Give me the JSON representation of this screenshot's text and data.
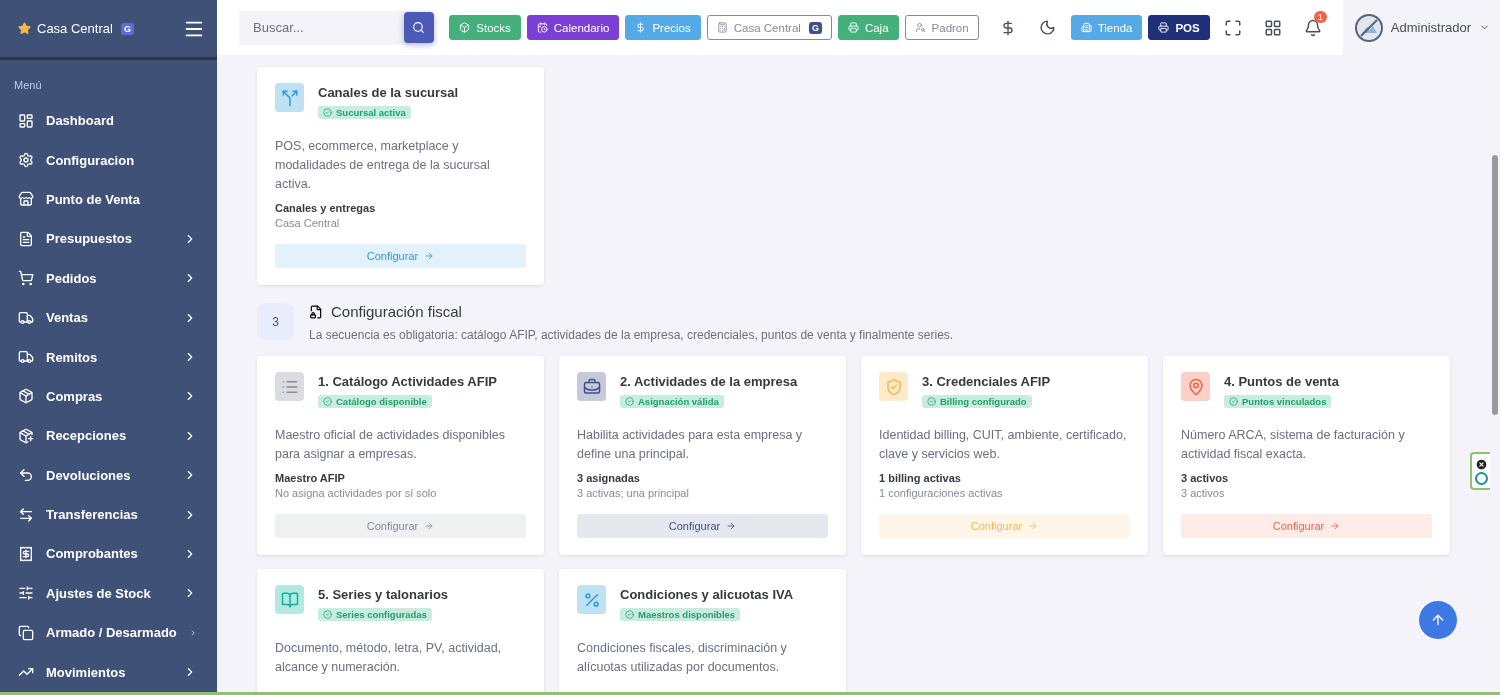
{
  "sidebar": {
    "brand": {
      "name": "Casa Central",
      "badge": "G"
    },
    "section_title": "Menú",
    "items": [
      {
        "label": "Dashboard",
        "expandable": false
      },
      {
        "label": "Configuracion",
        "expandable": false
      },
      {
        "label": "Punto de Venta",
        "expandable": false
      },
      {
        "label": "Presupuestos",
        "expandable": true
      },
      {
        "label": "Pedidos",
        "expandable": true
      },
      {
        "label": "Ventas",
        "expandable": true
      },
      {
        "label": "Remitos",
        "expandable": true
      },
      {
        "label": "Compras",
        "expandable": true
      },
      {
        "label": "Recepciones",
        "expandable": true
      },
      {
        "label": "Devoluciones",
        "expandable": true
      },
      {
        "label": "Transferencias",
        "expandable": true
      },
      {
        "label": "Comprobantes",
        "expandable": true
      },
      {
        "label": "Ajustes de Stock",
        "expandable": true
      },
      {
        "label": "Armado / Desarmado",
        "expandable": true
      },
      {
        "label": "Movimientos",
        "expandable": true
      }
    ]
  },
  "topbar": {
    "search": {
      "placeholder": "Buscar..."
    },
    "quick_buttons": [
      {
        "label": "Stocks",
        "kind": "solid",
        "color": "#45b07c"
      },
      {
        "label": "Calendario",
        "kind": "solid",
        "color": "#7b3fd4"
      },
      {
        "label": "Precios",
        "kind": "solid",
        "color": "#55a9e6"
      },
      {
        "label": "Casa Central",
        "kind": "outline",
        "color": "#878a99",
        "badge": "G"
      },
      {
        "label": "Caja",
        "kind": "solid",
        "color": "#45b07c"
      },
      {
        "label": "Padron",
        "kind": "outline",
        "color": "#878a99"
      }
    ],
    "mode_buttons": [
      {
        "label": "Tienda",
        "color": "#55a9e6"
      },
      {
        "label": "POS",
        "color": "#1f2f7a"
      }
    ],
    "notifications": "1",
    "user": "Administrador"
  },
  "top_card": {
    "title": "Canales de la sucursal",
    "status": "Sucursal activa",
    "color": "#299cdb",
    "description": "POS, ecommerce, marketplace y modalidades de entrega de la sucursal activa.",
    "meta_title": "Canales y entregas",
    "meta_detail": "Casa Central",
    "action": "Configurar"
  },
  "section": {
    "number": "3",
    "title": "Configuración fiscal",
    "subtitle": "La secuencia es obligatoria: catálogo AFIP, actividades de la empresa, credenciales, puntos de venta y finalmente series."
  },
  "cards": [
    {
      "title": "1. Catálogo Actividades AFIP",
      "status": "Catálogo disponible",
      "color": "#878a99",
      "description": "Maestro oficial de actividades disponibles para asignar a empresas.",
      "meta_title": "Maestro AFIP",
      "meta_detail": "No asigna actividades por sí solo",
      "action": "Configurar"
    },
    {
      "title": "2. Actividades de la empresa",
      "status": "Asignación válida",
      "color": "#405189",
      "description": "Habilita actividades para esta empresa y define una principal.",
      "meta_title": "3 asignadas",
      "meta_detail": "3 activas; una principal",
      "action": "Configurar"
    },
    {
      "title": "3. Credenciales AFIP",
      "status": "Billing configurado",
      "color": "#f7b84b",
      "description": "Identidad billing, CUIT, ambiente, certificado, clave y servicios web.",
      "meta_title": "1 billing activas",
      "meta_detail": "1 configuraciones activas",
      "action": "Configurar"
    },
    {
      "title": "4. Puntos de venta",
      "status": "Puntos vinculados",
      "color": "#f06548",
      "description": "Número ARCA, sistema de facturación y actividad fiscal exacta.",
      "meta_title": "3 activos",
      "meta_detail": "3 activos",
      "action": "Configurar"
    },
    {
      "title": "5. Series y talonarios",
      "status": "Series configuradas",
      "color": "#0ab39c",
      "description": "Documento, método, letra, PV, actividad, alcance y numeración."
    },
    {
      "title": "Condiciones y alicuotas IVA",
      "status": "Maestros disponibles",
      "color": "#299cdb",
      "description": "Condiciones fiscales, discriminación y alícuotas utilizadas por documentos."
    }
  ]
}
